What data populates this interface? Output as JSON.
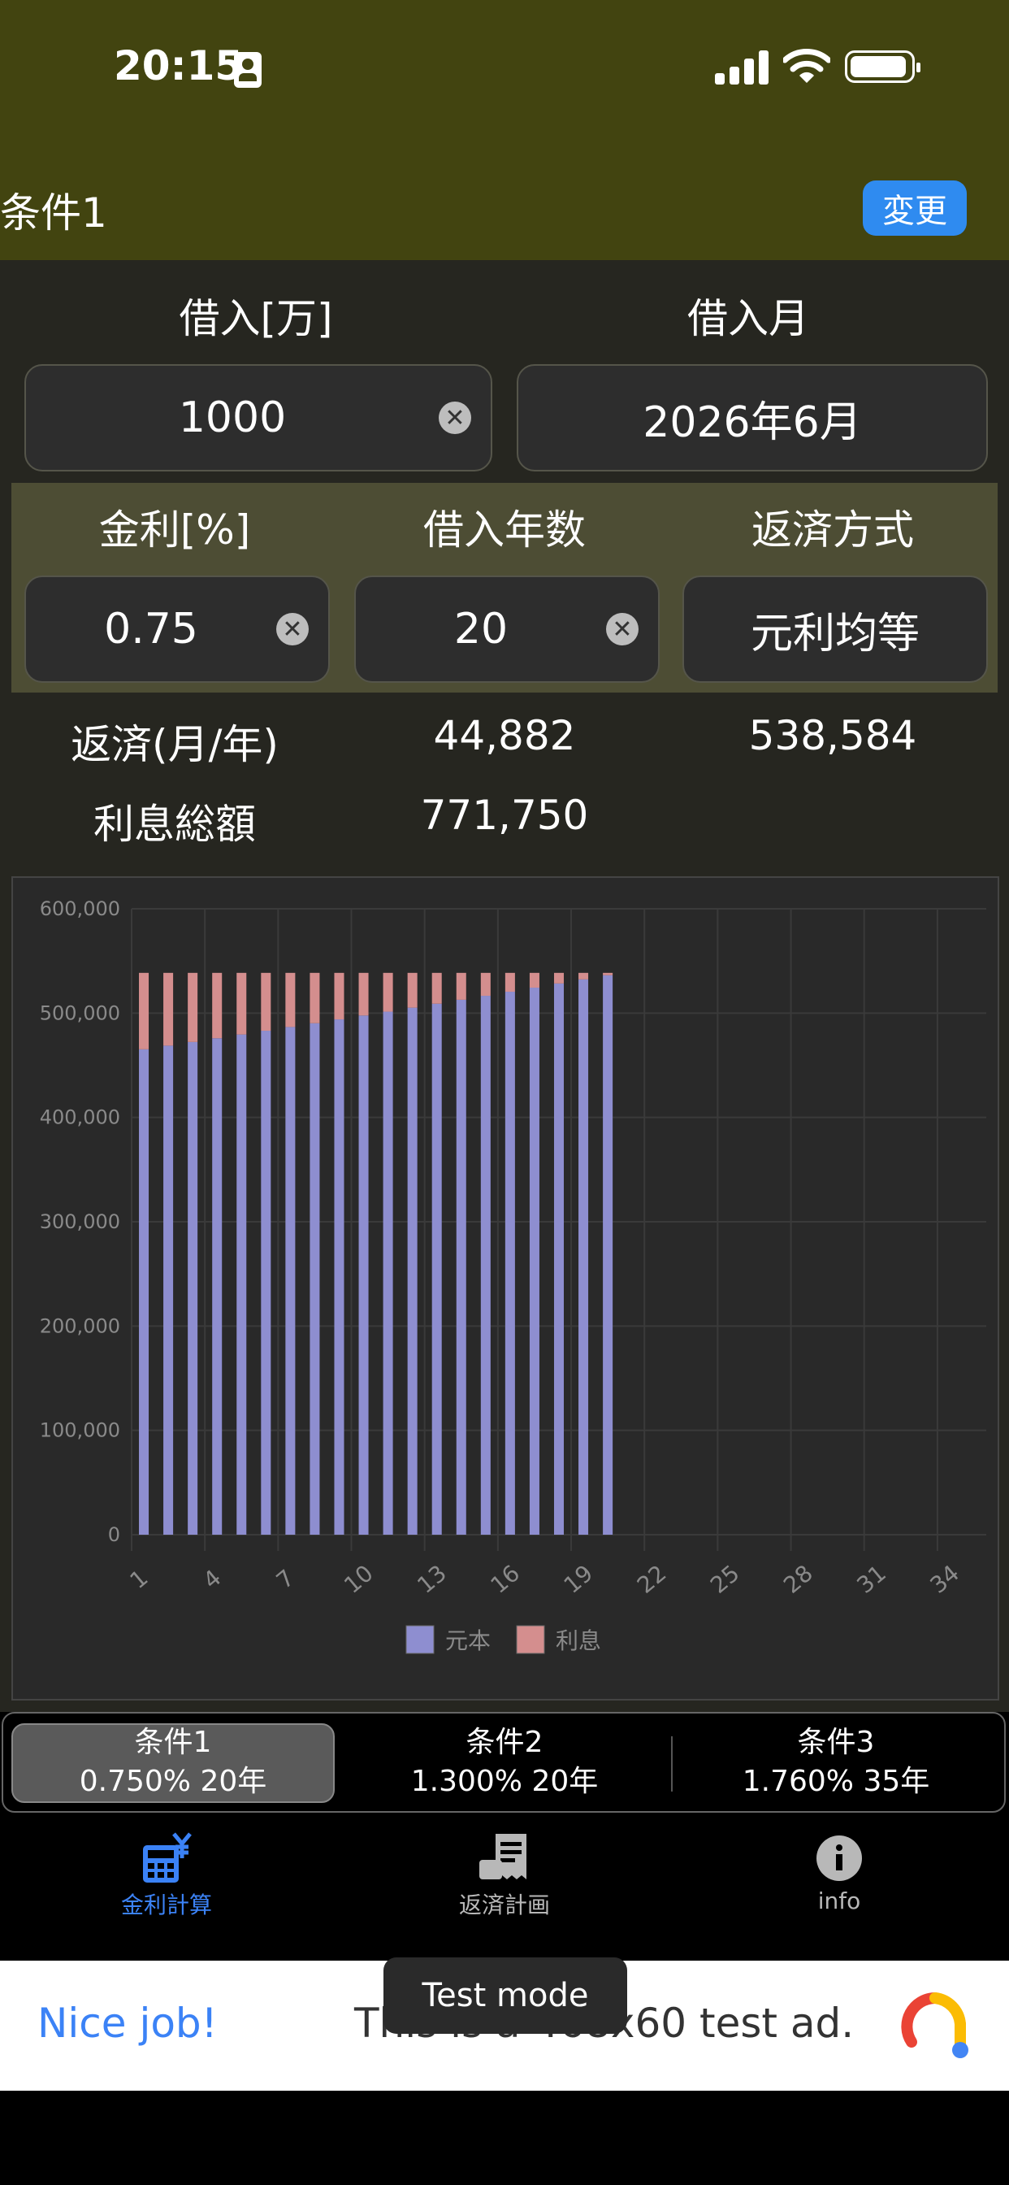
{
  "status": {
    "time": "20:15"
  },
  "header": {
    "title": "条件1",
    "change_label": "変更"
  },
  "form": {
    "loan_label": "借入[万]",
    "month_label": "借入月",
    "loan_value": "1000",
    "month_value": "2026年6月",
    "rate_label": "金利[%]",
    "years_label": "借入年数",
    "method_label": "返済方式",
    "rate_value": "0.75",
    "years_value": "20",
    "method_value": "元利均等"
  },
  "result": {
    "repay_label": "返済(月/年)",
    "monthly": "44,882",
    "yearly": "538,584",
    "interest_label": "利息総額",
    "interest_total": "771,750"
  },
  "chart_data": {
    "type": "bar",
    "stacked": true,
    "x": [
      1,
      2,
      3,
      4,
      5,
      6,
      7,
      8,
      9,
      10,
      11,
      12,
      13,
      14,
      15,
      16,
      17,
      18,
      19,
      20,
      21,
      22,
      23,
      24,
      25,
      26,
      27,
      28,
      29,
      30,
      31,
      32,
      33,
      34,
      35
    ],
    "x_tick_labels": [
      "1",
      "4",
      "7",
      "10",
      "13",
      "16",
      "19",
      "22",
      "25",
      "28",
      "31",
      "34"
    ],
    "y_tick_labels": [
      "0",
      "100,000",
      "200,000",
      "300,000",
      "400,000",
      "500,000",
      "600,000"
    ],
    "ylim": [
      0,
      600000
    ],
    "series": [
      {
        "name": "元本",
        "color": "#8e8ed0",
        "values": [
          465300,
          468800,
          472300,
          475900,
          479500,
          483100,
          486700,
          490300,
          494000,
          497700,
          501400,
          505200,
          509000,
          512800,
          516600,
          520500,
          524400,
          528400,
          532300,
          536300
        ]
      },
      {
        "name": "利息",
        "color": "#d48e8e",
        "values": [
          73284,
          69784,
          66284,
          62684,
          59084,
          55484,
          51884,
          48284,
          44584,
          40884,
          37184,
          33384,
          29584,
          25784,
          21984,
          18084,
          14184,
          10184,
          6284,
          2284
        ]
      }
    ],
    "legend_position": "bottom",
    "grid": true
  },
  "conditions": [
    {
      "name": "条件1",
      "detail": "0.750% 20年"
    },
    {
      "name": "条件2",
      "detail": "1.300% 20年"
    },
    {
      "name": "条件3",
      "detail": "1.760% 35年"
    }
  ],
  "nav": [
    {
      "label": "金利計算",
      "icon": "calculator-yen-icon",
      "active": true
    },
    {
      "label": "返済計画",
      "icon": "receipt-icon",
      "active": false
    },
    {
      "label": "info",
      "icon": "info-icon",
      "active": false
    }
  ],
  "ad": {
    "left_text": "Nice job!",
    "text": "This is a 468x60 test ad.",
    "badge": "Test mode"
  },
  "colors": {
    "header_bg": "#424410",
    "accent": "#2f8bf0",
    "panel": "#4d4d34"
  }
}
